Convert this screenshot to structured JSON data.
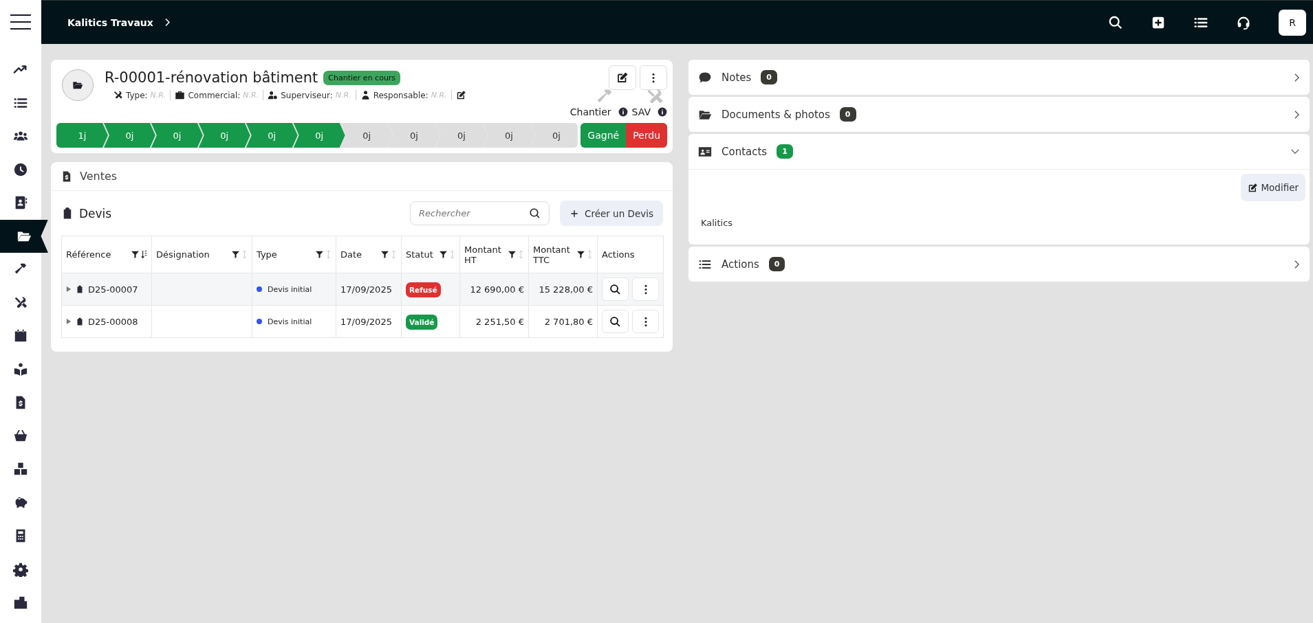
{
  "header": {
    "breadcrumb": "Kalitics Travaux",
    "avatar": "R"
  },
  "sidebar": {
    "items": [
      {
        "selected": false
      },
      {
        "selected": false
      },
      {
        "selected": false
      },
      {
        "selected": false
      },
      {
        "selected": false
      },
      {
        "selected": true
      },
      {
        "selected": false
      },
      {
        "selected": false
      },
      {
        "selected": false
      },
      {
        "selected": false
      },
      {
        "selected": false
      },
      {
        "selected": false
      },
      {
        "selected": false
      },
      {
        "selected": false
      },
      {
        "selected": false
      },
      {
        "selected": false
      },
      {
        "selected": false
      }
    ]
  },
  "project": {
    "title": "R-00001-rénovation bâtiment",
    "status": "Chantier en cours",
    "meta": [
      {
        "label": "Type:",
        "value": "N.R."
      },
      {
        "label": "Commercial:",
        "value": "N.R."
      },
      {
        "label": "Superviseur:",
        "value": "N.R."
      },
      {
        "label": "Responsable:",
        "value": "N.R."
      }
    ],
    "modules": [
      {
        "label": "Chantier"
      },
      {
        "label": "SAV"
      }
    ],
    "stages": [
      {
        "label": "1j",
        "done": true
      },
      {
        "label": "0j",
        "done": true
      },
      {
        "label": "0j",
        "done": true
      },
      {
        "label": "0j",
        "done": true
      },
      {
        "label": "0j",
        "done": true
      },
      {
        "label": "0j",
        "done": true
      },
      {
        "label": "0j",
        "done": false
      },
      {
        "label": "0j",
        "done": false
      },
      {
        "label": "0j",
        "done": false
      },
      {
        "label": "0j",
        "done": false
      },
      {
        "label": "0j",
        "done": false
      }
    ],
    "outcomes": [
      {
        "label": "Gagné",
        "color": "#16994a"
      },
      {
        "label": "Perdu",
        "color": "#e03131"
      }
    ]
  },
  "sales": {
    "title": "Ventes",
    "section": "Devis",
    "search": {
      "placeholder": "Rechercher"
    },
    "create_button": "Créer un Devis",
    "columns": [
      {
        "label": "Référence",
        "sorted": true
      },
      {
        "label": "Désignation",
        "sorted": false
      },
      {
        "label": "Type",
        "sorted": false
      },
      {
        "label": "Date",
        "sorted": false
      },
      {
        "label": "Statut",
        "sorted": false
      },
      {
        "label": "Montant HT",
        "sorted": false
      },
      {
        "label": "Montant TTC",
        "sorted": false
      },
      {
        "label": "Actions"
      }
    ],
    "rows": [
      {
        "reference": "D25-00007",
        "type": {
          "label": "Devis initial",
          "color": "#3355ee"
        },
        "date": "17/09/2025",
        "status": {
          "label": "Refusé",
          "color": "#e03131"
        },
        "amount_ht": "12 690,00 €",
        "amount_ttc": "15 228,00 €"
      },
      {
        "reference": "D25-00008",
        "type": {
          "label": "Devis initial",
          "color": "#3355ee"
        },
        "date": "17/09/2025",
        "status": {
          "label": "Validé",
          "color": "#16994a"
        },
        "amount_ht": "2 251,50 €",
        "amount_ttc": "2 701,80 €"
      }
    ]
  },
  "panels": [
    {
      "title": "Notes",
      "count": "0",
      "color": "#3a3a33",
      "expanded": false
    },
    {
      "title": "Documents & photos",
      "count": "0",
      "color": "#3a3a33",
      "expanded": false
    },
    {
      "title": "Contacts",
      "count": "1",
      "color": "#16994a",
      "expanded": true,
      "button": "Modifier",
      "contacts": [
        "Kalitics"
      ]
    },
    {
      "title": "Actions",
      "count": "0",
      "color": "#3a3a33",
      "expanded": false
    }
  ]
}
